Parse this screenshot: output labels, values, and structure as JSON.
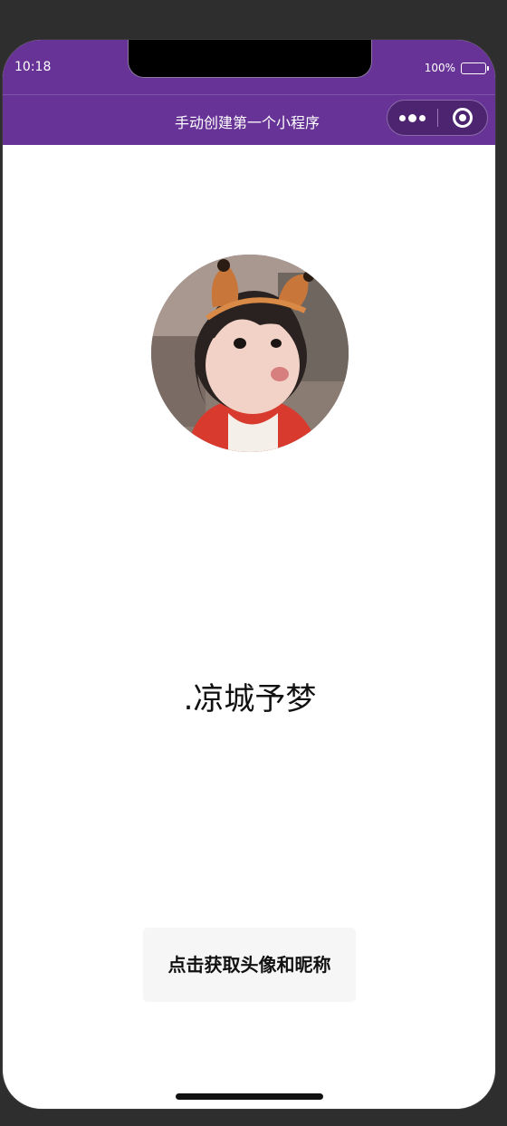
{
  "status_bar": {
    "time": "10:18",
    "battery": "100%"
  },
  "nav": {
    "title": "手动创建第一个小程序"
  },
  "capsule": {
    "more_icon": "more-dots-icon",
    "close_icon": "target-circle-icon"
  },
  "profile": {
    "nickname": ".凉城予梦",
    "avatar_icon": "avatar-photo"
  },
  "action": {
    "button_label": "点击获取头像和昵称"
  },
  "colors": {
    "theme": "#673396",
    "background": "#ffffff",
    "button_bg": "#f6f6f6"
  }
}
